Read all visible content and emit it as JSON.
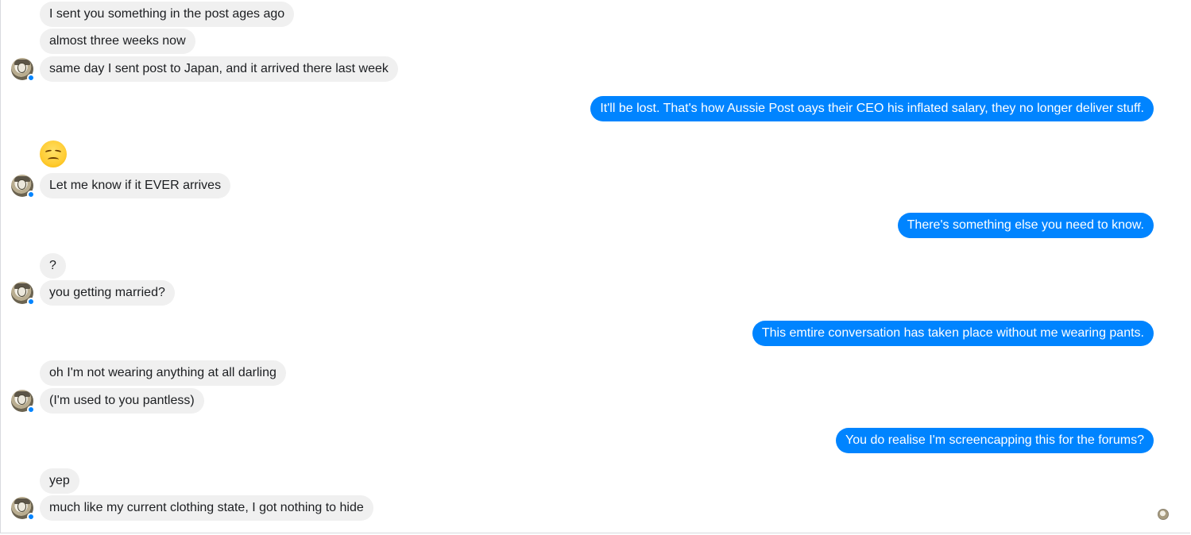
{
  "messages": [
    {
      "side": "in",
      "text": "I sent you something in the post ages ago"
    },
    {
      "side": "in",
      "text": "almost three weeks now"
    },
    {
      "side": "in",
      "text": "same day I sent post to Japan, and it arrived there last week"
    },
    {
      "side": "out",
      "text": "It'll be lost. That's how Aussie Post oays their CEO his inflated salary, they no longer deliver stuff."
    },
    {
      "side": "in",
      "emoji": "disappointed-face-emoji"
    },
    {
      "side": "in",
      "text": "Let me know if it EVER arrives"
    },
    {
      "side": "out",
      "text": "There's something else you need to know."
    },
    {
      "side": "in",
      "text": "?"
    },
    {
      "side": "in",
      "text": "you getting married?"
    },
    {
      "side": "out",
      "text": "This emtire conversation has taken place without me wearing pants."
    },
    {
      "side": "in",
      "text": "oh I'm not wearing anything at all darling"
    },
    {
      "side": "in",
      "text": "(I'm used to you pantless)"
    },
    {
      "side": "out",
      "text": "You do realise I'm screencapping this for the forums?"
    },
    {
      "side": "in",
      "text": "yep"
    },
    {
      "side": "in",
      "text": "much like my current clothing state, I got nothing to hide"
    }
  ],
  "colors": {
    "incoming_bubble": "#f0f0f0",
    "outgoing_bubble": "#0084ff",
    "incoming_text": "#1c1e21",
    "outgoing_text": "#ffffff"
  },
  "icons": {
    "contact_avatar": "contact-avatar-icon",
    "messenger_badge": "messenger-badge-icon",
    "read_receipt": "read-receipt-avatar-icon"
  }
}
